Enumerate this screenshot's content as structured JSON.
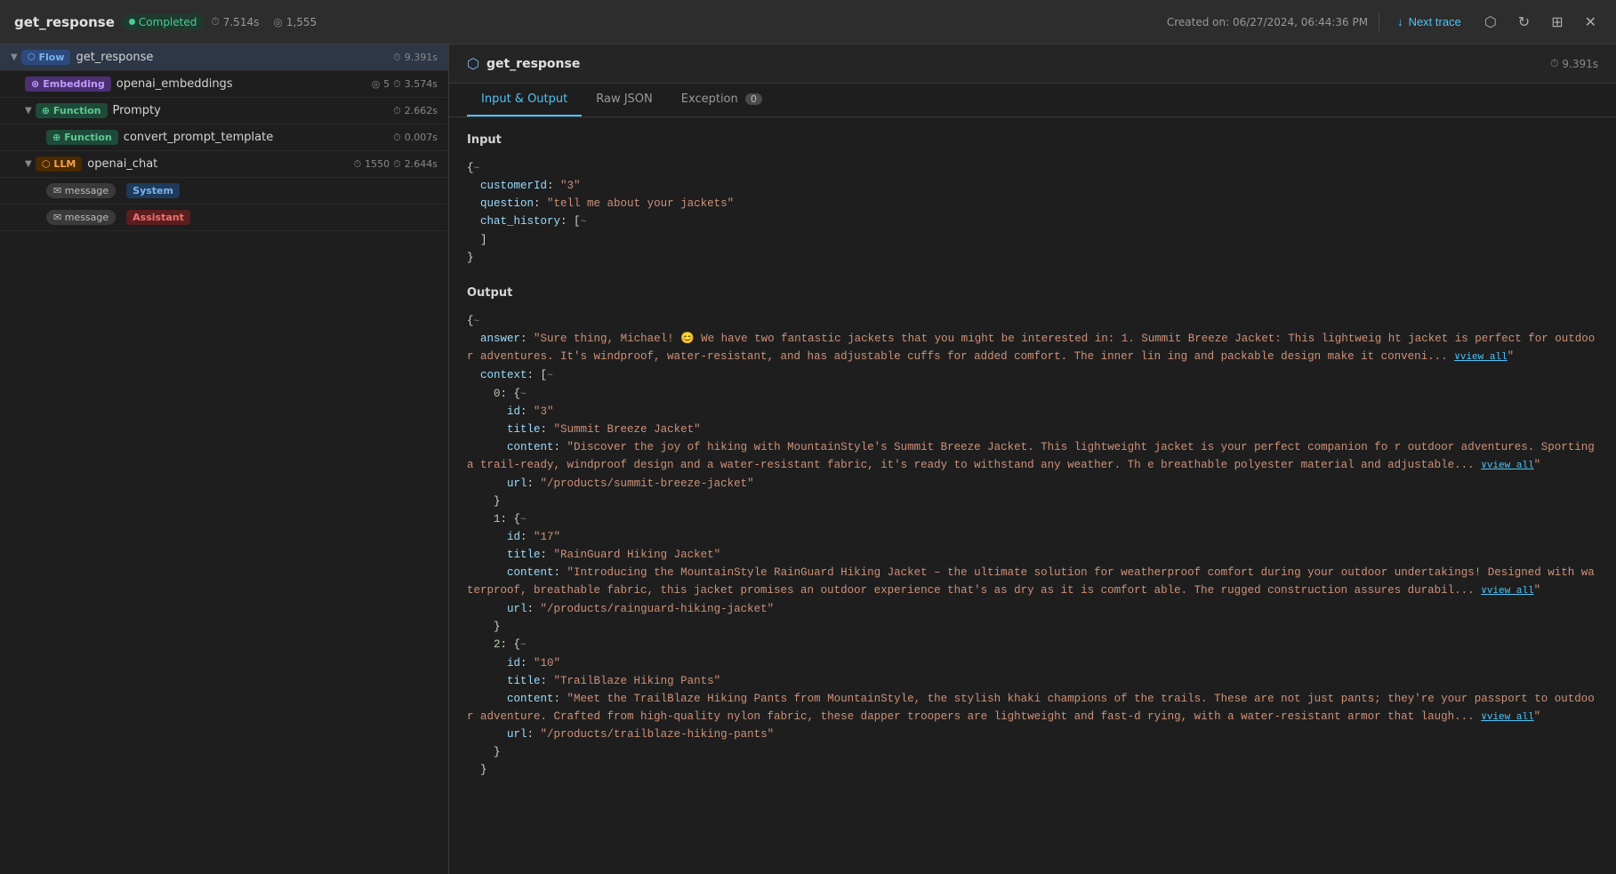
{
  "header": {
    "title": "get_response",
    "status": "Completed",
    "duration": "7.514s",
    "tokens": "1,555",
    "created": "Created on: 06/27/2024, 06:44:36 PM",
    "next_trace_label": "Next trace"
  },
  "icons": {
    "clock": "⏱",
    "token": "◎",
    "down_arrow": "↓",
    "share": "⬡",
    "refresh": "↻",
    "grid": "⊞",
    "close": "✕",
    "collapse_icon": "{~",
    "view_all": "∨view all"
  },
  "left_panel": {
    "items": [
      {
        "id": "flow-root",
        "indent": 0,
        "badge": "Flow",
        "badge_type": "flow",
        "name": "get_response",
        "time": "9.391s",
        "has_chevron": true,
        "expanded": true
      },
      {
        "id": "embedding-1",
        "indent": 1,
        "badge": "Embedding",
        "badge_type": "embedding",
        "name": "openai_embeddings",
        "time_icon": "5",
        "time": "3.574s",
        "has_chevron": false
      },
      {
        "id": "function-1",
        "indent": 1,
        "badge": "Function",
        "badge_type": "function",
        "name": "Prompty",
        "time": "2.662s",
        "has_chevron": true,
        "expanded": true
      },
      {
        "id": "function-2",
        "indent": 2,
        "badge": "Function",
        "badge_type": "function",
        "name": "convert_prompt_template",
        "time": "0.007s",
        "has_chevron": false
      },
      {
        "id": "llm-1",
        "indent": 1,
        "badge": "LLM",
        "badge_type": "llm",
        "name": "openai_chat",
        "tokens": "1550",
        "time": "2.644s",
        "has_chevron": true,
        "expanded": true
      },
      {
        "id": "msg-system",
        "indent": 2,
        "badge": "message",
        "badge_type": "message",
        "system_badge": "System",
        "has_chevron": false
      },
      {
        "id": "msg-assistant",
        "indent": 2,
        "badge": "message",
        "badge_type": "message",
        "assistant_badge": "Assistant",
        "has_chevron": false
      }
    ]
  },
  "right_panel": {
    "title": "get_response",
    "time": "9.391s",
    "tabs": [
      {
        "id": "input-output",
        "label": "Input & Output",
        "active": true
      },
      {
        "id": "raw-json",
        "label": "Raw JSON",
        "active": false
      },
      {
        "id": "exception",
        "label": "Exception",
        "active": false,
        "badge": "0"
      }
    ],
    "input_label": "Input",
    "input_content": [
      "{{~",
      "  customerId: \"3\"",
      "  question: \"tell me about your jackets\"",
      "  chat_history: [{~",
      "  ]",
      "}"
    ],
    "output_label": "Output",
    "output_content": [
      "{{~",
      "  answer: \"Sure thing, Michael! 😊 We have two fantastic jackets that you might be interested in: 1. Summit Breeze Jacket: This lightweig ht jacket is perfect for outdoor adventures. It's windproof, water-resistant, and has adjustable cuffs for added comfort. The inner lin ing and packable design make it conveni... ∨view all\"",
      "  context: [{~",
      "    0: {{~",
      "      id: \"3\"",
      "      title: \"Summit Breeze Jacket\"",
      "      content: \"Discover the joy of hiking with MountainStyle's Summit Breeze Jacket. This lightweight jacket is your perfect companion fo r outdoor adventures. Sporting a trail-ready, windproof design and a water-resistant fabric, it's ready to withstand any weather. Th e breathable polyester material and adjustable... ∨view all\"",
      "      url: \"/products/summit-breeze-jacket\"",
      "    }",
      "    1: {{~",
      "      id: \"17\"",
      "      title: \"RainGuard Hiking Jacket\"",
      "      content: \"Introducing the MountainStyle RainGuard Hiking Jacket – the ultimate solution for weatherproof comfort during your outdoor undertakings! Designed with waterproof, breathable fabric, this jacket promises an outdoor experience that's as dry as it is comfort able. The rugged construction assures durabil... ∨view all\"",
      "      url: \"/products/rainguard-hiking-jacket\"",
      "    }",
      "    2: {{~",
      "      id: \"10\"",
      "      title: \"TrailBlaze Hiking Pants\"",
      "      content: \"Meet the TrailBlaze Hiking Pants from MountainStyle, the stylish khaki champions of the trails. These are not just pants; they're your passport to outdoor adventure. Crafted from high-quality nylon fabric, these dapper troopers are lightweight and fast-d rying, with a water-resistant armor that laugh... ∨view all\"",
      "      url: \"/products/trailblaze-hiking-pants\"",
      "    }",
      "  }"
    ]
  }
}
